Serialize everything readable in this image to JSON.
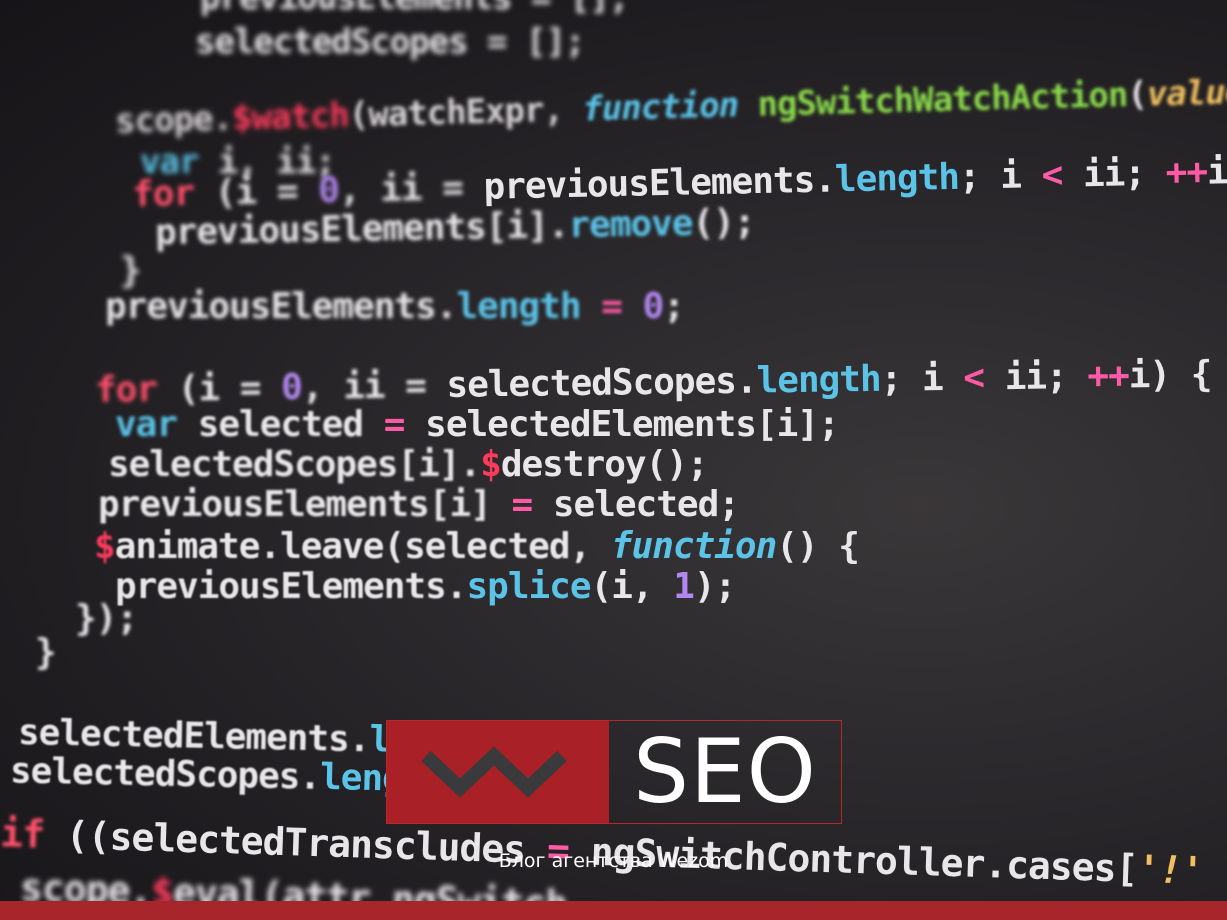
{
  "brand": {
    "logo_text": "SEO",
    "tagline": "Блог агентства Wezom"
  },
  "colors": {
    "brand_red": "#a92026",
    "bottom_bar": "#a7262b",
    "background": "#2c2a2d"
  },
  "icons": {
    "logo_mark": "wezom-w-logo-icon"
  }
}
